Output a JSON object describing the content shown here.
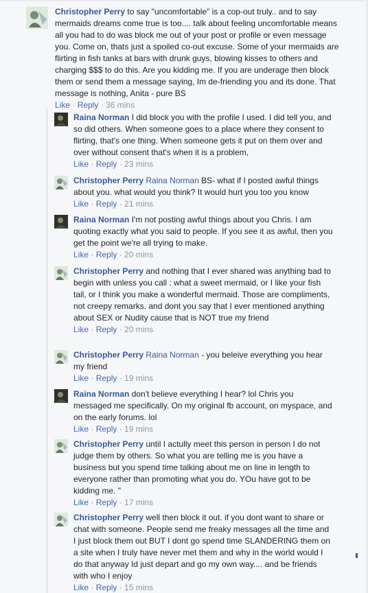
{
  "comments": [
    {
      "author": "Christopher Perry",
      "mention": "",
      "text": "to say \"uncomfortable\" is a cop-out truly.. and to say mermaids dreams come true is too.... talk about feeling uncomfortable means all you had to do was block me out of your post or profile or even message you. Come on, thats just a spoiled co-out excuse. Some of your mermaids are flirting in fish tanks at bars with drunk guys, blowing kisses to others and charging $$$ to do this. Are you kidding me. If you are underage then block them or send them a message saying, Im de-friending you and its done. That message is nothing, Anita - pure BS",
      "like": "Like",
      "reply": "Reply",
      "time": "36 mins"
    },
    {
      "author": "Raina Norman",
      "mention": "",
      "text": "I did block you with the profile I used. I did tell you, and so did others. When someone goes to a place where they consent to flirting, that's one thing. When someone gets it put on them over and over without consent that's when it is a problem,",
      "like": "Like",
      "reply": "Reply",
      "time": "23 mins"
    },
    {
      "author": "Christopher Perry",
      "mention": "Raina Norman",
      "text": "BS- what if I posted awful things about you. what would you think? It would hurt you too you know",
      "like": "Like",
      "reply": "Reply",
      "time": "21 mins"
    },
    {
      "author": "Raina Norman",
      "mention": "",
      "text": "I'm not posting awful things about you Chris. I am quoting exactly what you said to people. If you see it as awful, then you get the point we're all trying to make.",
      "like": "Like",
      "reply": "Reply",
      "time": "20 mins"
    },
    {
      "author": "Christopher Perry",
      "mention": "",
      "text": "and nothing that I ever shared was anything bad to begin with unless you call : what a sweet mermaid, or I like your fish tail, or I think you make a wonderful mermaid. Those are compliments, not creepy remarks. and dont you say that I ever mentioned anything about SEX or Nudity cause that is NOT true my friend",
      "like": "Like",
      "reply": "Reply",
      "time": "20 mins"
    },
    {
      "author": "Christopher Perry",
      "mention": "Raina Norman",
      "text": "- you beleive everything you hear my friend",
      "like": "Like",
      "reply": "Reply",
      "time": "19 mins"
    },
    {
      "author": "Raina Norman",
      "mention": "",
      "text": "don't believe everything I hear? lol Chris you messaged me specifically. On my original fb account, on myspace, and on the early forums. lol",
      "like": "Like",
      "reply": "Reply",
      "time": "19 mins"
    },
    {
      "author": "Christopher Perry",
      "mention": "",
      "text": "until I actully meet this person in person I do not judge them by others. So what you are telling me is you have a business but you spend time talking about me on line in length to everyone rather than promoting what you do. YOu have got to be kidding me. \"",
      "like": "Like",
      "reply": "Reply",
      "time": "17 mins"
    },
    {
      "author": "Christopher Perry",
      "mention": "",
      "text": "well then block it out. if you dont want to share or chat with someone. People send me freaky messages all the time and I just block them out BUT I dont go spend time SLANDERING them on a site when I truly have never met them and why in the world would I do that anyway Id just depart and go my own way.... and be friends with who I enjoy",
      "like": "Like",
      "reply": "Reply",
      "time": "15 mins"
    }
  ]
}
